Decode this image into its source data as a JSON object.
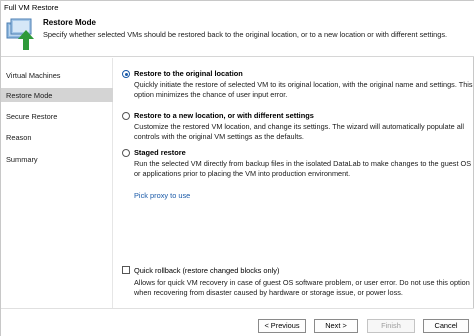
{
  "window": {
    "title": "Full VM Restore"
  },
  "header": {
    "title": "Restore Mode",
    "subtitle": "Specify whether selected VMs should be restored back to the original location, or to a new location or with different settings.",
    "icon": "vm-restore-icon"
  },
  "sidebar": {
    "items": [
      {
        "label": "Virtual Machines",
        "active": false
      },
      {
        "label": "Restore Mode",
        "active": true
      },
      {
        "label": "Secure Restore",
        "active": false
      },
      {
        "label": "Reason",
        "active": false
      },
      {
        "label": "Summary",
        "active": false
      }
    ]
  },
  "options": [
    {
      "label": "Restore to the original location",
      "selected": true,
      "description": "Quickly initiate the restore of selected VM to its original location, with the original name and settings. This option minimizes the chance of user input error."
    },
    {
      "label": "Restore to a new location, or with different settings",
      "selected": false,
      "description": "Customize the restored VM location, and change its settings. The wizard will automatically populate all controls with the original VM settings as the defaults."
    },
    {
      "label": "Staged restore",
      "selected": false,
      "description": "Run the selected VM directly from backup files in the isolated DataLab to make changes to the guest OS or applications prior to placing the VM into production environment."
    }
  ],
  "pick_proxy_link": "Pick proxy to use",
  "quick_rollback": {
    "label": "Quick rollback (restore changed blocks only)",
    "checked": false,
    "description": "Allows for quick VM recovery in case of guest OS software problem, or user error. Do not use this option when recovering from disaster caused by hardware or storage issue, or power loss."
  },
  "footer": {
    "previous": "< Previous",
    "next": "Next >",
    "finish": "Finish",
    "cancel": "Cancel"
  },
  "colors": {
    "accent": "#1a5aa8",
    "active_nav": "#d4d4d4",
    "arrow": "#2e9a3a"
  }
}
